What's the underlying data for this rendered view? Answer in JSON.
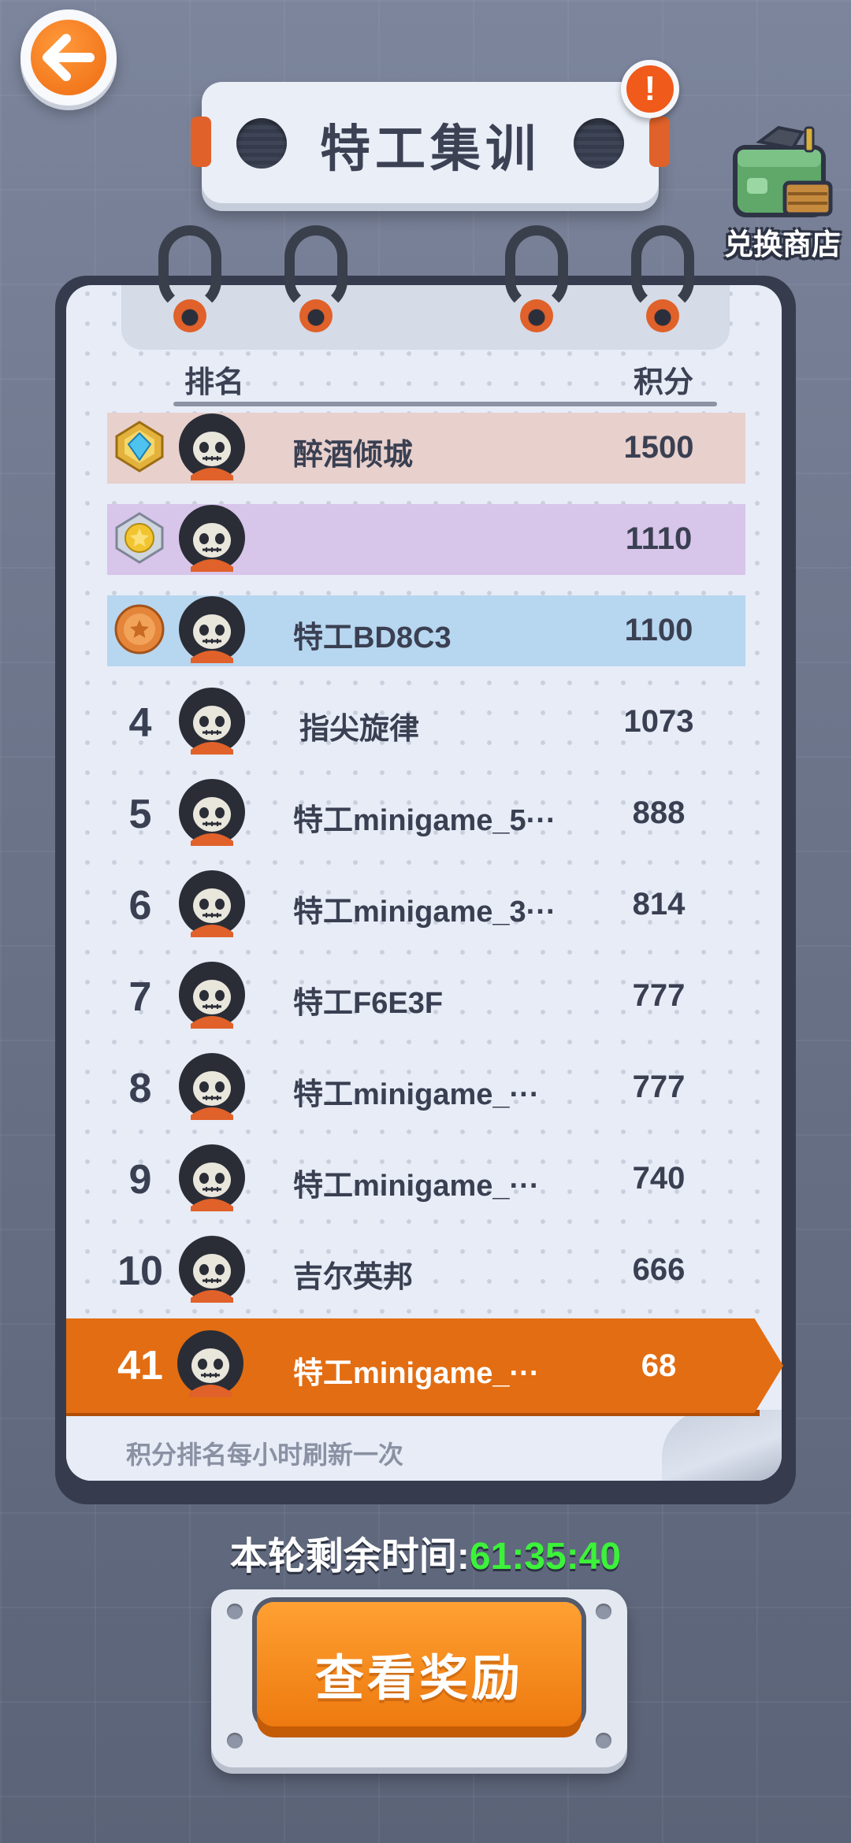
{
  "header": {
    "back_icon": "arrow-left-icon",
    "title": "特工集训",
    "info_icon_text": "!",
    "shop_label": "兑换商店"
  },
  "leaderboard": {
    "col_rank": "排名",
    "col_score": "积分",
    "rows": [
      {
        "rank": "",
        "medal": "diamond-medal-icon",
        "name": "醉酒倾城",
        "score": "1500"
      },
      {
        "rank": "",
        "medal": "gold-medal-icon",
        "name": "",
        "score": "1110"
      },
      {
        "rank": "",
        "medal": "bronze-medal-icon",
        "name": "特工BD8C3",
        "score": "1100"
      },
      {
        "rank": "4",
        "name": "指尖旋律",
        "score": "1073"
      },
      {
        "rank": "5",
        "name": "特工minigame_5···",
        "score": "888"
      },
      {
        "rank": "6",
        "name": "特工minigame_3···",
        "score": "814"
      },
      {
        "rank": "7",
        "name": "特工F6E3F",
        "score": "777"
      },
      {
        "rank": "8",
        "name": "特工minigame_···",
        "score": "777"
      },
      {
        "rank": "9",
        "name": "特工minigame_···",
        "score": "740"
      },
      {
        "rank": "10",
        "name": "吉尔英邦",
        "score": "666"
      }
    ],
    "my_row": {
      "rank": "41",
      "name": "特工minigame_···",
      "score": "68"
    },
    "refresh_note": "积分排名每小时刷新一次"
  },
  "timer": {
    "label": "本轮剩余时间:",
    "value": "61:35:40"
  },
  "reward_button": "查看奖励",
  "colors": {
    "accent_orange": "#e36d12",
    "timer_green": "#3cf23a",
    "gold_row": "#e8d0cd",
    "silver_row": "#d8c5ea",
    "bronze_row": "#b7d6f0"
  }
}
